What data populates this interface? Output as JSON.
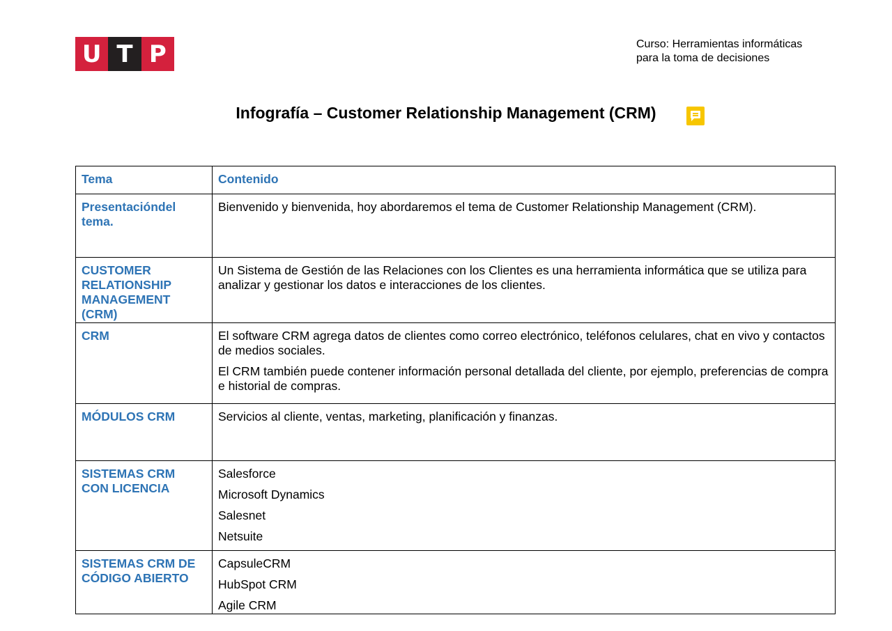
{
  "logo": {
    "letters": [
      "U",
      "T",
      "P"
    ],
    "colors": [
      "#d4213d",
      "#231f20",
      "#d4213d"
    ]
  },
  "course": {
    "line1": "Curso: Herramientas informáticas",
    "line2": "para la toma de decisiones"
  },
  "title": "Infografía – Customer Relationship Management (CRM)",
  "comment_icon": "comment-icon",
  "table": {
    "headers": {
      "tema": "Tema",
      "contenido": "Contenido"
    },
    "rows": [
      {
        "tema": "Presentacióndel tema.",
        "contenido": [
          "Bienvenido y bienvenida, hoy abordaremos el tema de Customer Relationship Management (CRM)."
        ]
      },
      {
        "tema": "CUSTOMER RELATIONSHIP MANAGEMENT (CRM)",
        "contenido": [
          "Un Sistema de Gestión de las Relaciones con los Clientes es una herramienta informática que se utiliza para analizar y gestionar los datos e interacciones de los clientes."
        ]
      },
      {
        "tema": "CRM",
        "contenido": [
          "El software CRM agrega datos de clientes como correo electrónico, teléfonos celulares, chat en vivo y contactos de medios sociales.",
          "El CRM también puede contener información personal detallada del cliente, por ejemplo, preferencias de compra e historial de compras."
        ]
      },
      {
        "tema": "MÓDULOS CRM",
        "contenido": [
          "Servicios al cliente, ventas, marketing, planificación y finanzas."
        ]
      },
      {
        "tema": "SISTEMAS CRM CON LICENCIA",
        "contenido": [
          "Salesforce",
          "Microsoft Dynamics",
          "Salesnet",
          "Netsuite"
        ]
      },
      {
        "tema": "SISTEMAS CRM DE CÓDIGO ABIERTO",
        "contenido": [
          "CapsuleCRM",
          "HubSpot CRM",
          "Agile CRM"
        ]
      }
    ]
  }
}
